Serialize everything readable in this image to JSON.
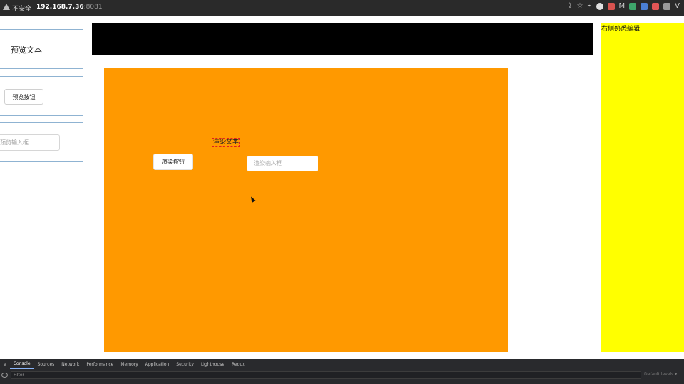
{
  "browser": {
    "security_label": "不安全",
    "separator": "|",
    "url_host": "192.168.7.36",
    "url_port": ":8081"
  },
  "left_panel": {
    "preview_text": "预览文本",
    "preview_button": "预览按钮",
    "preview_input_placeholder": "预览输入框"
  },
  "canvas": {
    "render_button": "渲染按钮",
    "render_text": "渲染文本",
    "render_input_placeholder": "渲染输入框",
    "background_color": "#ff9900"
  },
  "right_panel": {
    "title": "右侧熟悉编辑",
    "background_color": "#ffff00"
  },
  "devtools": {
    "tabs": [
      "e",
      "Console",
      "Sources",
      "Network",
      "Performance",
      "Memory",
      "Application",
      "Security",
      "Lighthouse",
      "Redux"
    ],
    "active_tab": "Console",
    "filter_placeholder": "Filter",
    "levels_label": "Default levels ▾"
  }
}
